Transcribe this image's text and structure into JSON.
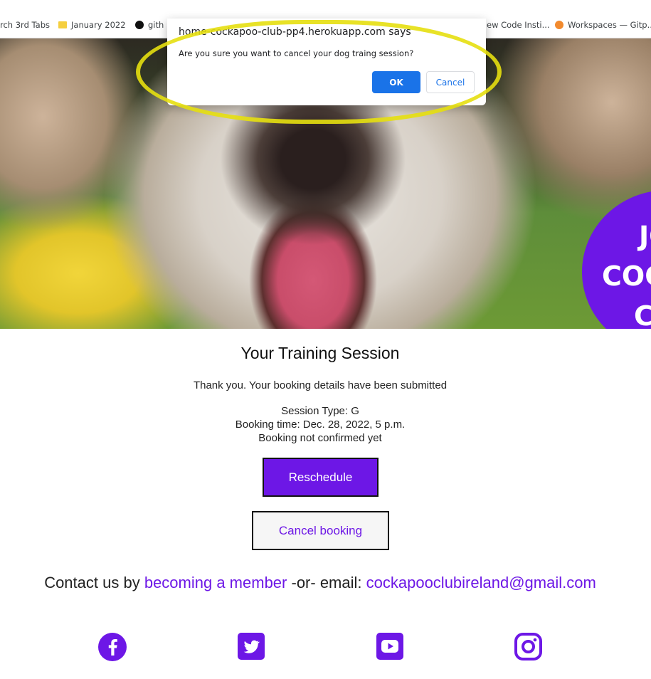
{
  "bookmarks": [
    {
      "label": "rch 3rd Tabs",
      "icon": "none"
    },
    {
      "label": "January 2022",
      "icon": "folder-icon"
    },
    {
      "label": "gith",
      "icon": "github-icon"
    },
    {
      "label": "ew Code Insti...",
      "icon": "none"
    },
    {
      "label": "Workspaces — Gitp...",
      "icon": "gitpod-icon"
    }
  ],
  "hero": {
    "banner_lines": [
      "JO",
      "COCK",
      "CL"
    ]
  },
  "dialog": {
    "title": "home-cockapoo-club-pp4.herokuapp.com says",
    "message": "Are you sure you want to cancel your dog traing session?",
    "ok_label": "OK",
    "cancel_label": "Cancel"
  },
  "session": {
    "heading": "Your Training Session",
    "thank_you": "Thank you. Your booking details have been submitted",
    "type_line": "Session Type: G",
    "time_line": "Booking time: Dec. 28, 2022, 5 p.m.",
    "status_line": "Booking not confirmed yet",
    "reschedule_label": "Reschedule",
    "cancel_booking_label": "Cancel booking"
  },
  "contact": {
    "prefix": "Contact us by ",
    "member_link": "becoming a member",
    "middle": " -or- email: ",
    "email_link": "cockapooclubireland@gmail.com"
  },
  "social": [
    "facebook-icon",
    "twitter-icon",
    "youtube-icon",
    "instagram-icon"
  ],
  "colors": {
    "accent": "#6d17e6",
    "dialog_button": "#1a73e8",
    "highlight": "#e6df10"
  }
}
